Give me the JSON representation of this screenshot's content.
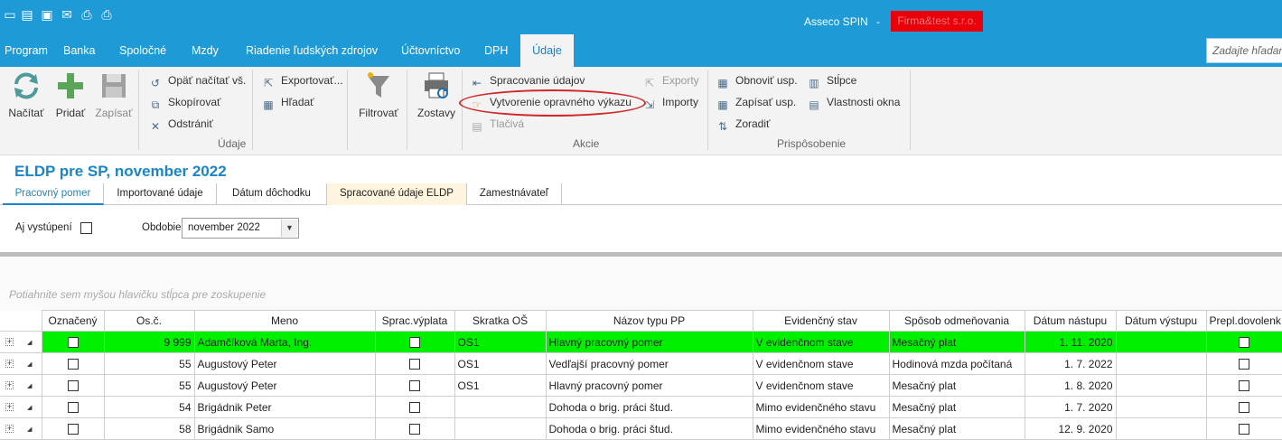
{
  "titlebar": {
    "app_name": "Asseco SPIN",
    "separator": "-",
    "company": "Firma&test s.r.o."
  },
  "menu": {
    "tabs": [
      "Program",
      "Banka",
      "Spoločné",
      "Mzdy",
      "Riadenie ľudských zdrojov",
      "Účtovníctvo",
      "DPH",
      "Údaje"
    ],
    "active": "Údaje",
    "search_placeholder": "Zadajte hľadaný"
  },
  "ribbon": {
    "udaje_group": {
      "label": "Údaje",
      "nacitat": "Načítať",
      "pridat": "Pridať",
      "zapisat": "Zapísať",
      "opat_nacitat": "Opäť načítať vš.",
      "skopirovat": "Skopírovať",
      "odstranit": "Odstrániť",
      "exportovat": "Exportovať...",
      "hladat": "Hľadať"
    },
    "filtrovat": "Filtrovať",
    "zostavy": "Zostavy",
    "akcie_group": {
      "label": "Akcie",
      "spracovanie": "Spracovanie údajov",
      "vytvorenie": "Vytvorenie opravného výkazu",
      "tlaciva": "Tlačivá",
      "exporty": "Exporty",
      "importy": "Importy"
    },
    "prisposobenie_group": {
      "label": "Prispôsobenie",
      "obnovit": "Obnoviť usp.",
      "zapisat_usp": "Zapísať usp.",
      "zoradit": "Zoradiť",
      "stlpce": "Stĺpce",
      "vlastnosti": "Vlastnosti okna"
    }
  },
  "page": {
    "title": "ELDP pre SP, november 2022",
    "subtabs": [
      "Pracovný pomer",
      "Importované údaje",
      "Dátum dôchodku",
      "Spracované údaje ELDP",
      "Zamestnávateľ"
    ],
    "filter_vystupeni_label": "Aj vystúpení",
    "filter_obdobie_label": "Obdobie",
    "filter_obdobie_value": "november 2022",
    "group_hint": "Potiahnite sem myšou hlavičku stĺpca pre zoskupenie"
  },
  "grid": {
    "columns": [
      "Označený",
      "Os.č.",
      "Meno",
      "Sprac.výplata",
      "Skratka OŠ",
      "Názov typu PP",
      "Evidenčný stav",
      "Spôsob odmeňovania",
      "Dátum nástupu",
      "Dátum výstupu",
      "Prepl.dovolenk"
    ],
    "rows": [
      {
        "osc": "9 999",
        "meno": "Adamčíková Marta, Ing.",
        "skratka": "OS1",
        "typ": "Hlavný pracovný pomer",
        "stav": "V evidenčnom stave",
        "odmena": "Mesačný plat",
        "nastup": "1. 11. 2020",
        "vystup": "",
        "selected": true
      },
      {
        "osc": "55",
        "meno": "Augustový Peter",
        "skratka": "OS1",
        "typ": "Vedľajší pracovný pomer",
        "stav": "V evidenčnom stave",
        "odmena": "Hodinová mzda počítaná",
        "nastup": "1. 7. 2022",
        "vystup": "",
        "selected": false
      },
      {
        "osc": "55",
        "meno": "Augustový Peter",
        "skratka": "OS1",
        "typ": "Hlavný pracovný pomer",
        "stav": "V evidenčnom stave",
        "odmena": "Mesačný plat",
        "nastup": "1. 8. 2020",
        "vystup": "",
        "selected": false
      },
      {
        "osc": "54",
        "meno": "Brigádnik Peter",
        "skratka": "",
        "typ": "Dohoda o brig. práci štud.",
        "stav": "Mimo evidenčného stavu",
        "odmena": "Mesačný plat",
        "nastup": "1. 7. 2020",
        "vystup": "",
        "selected": false
      },
      {
        "osc": "58",
        "meno": "Brigádnik Samo",
        "skratka": "",
        "typ": "Dohoda o brig. práci štud.",
        "stav": "Mimo evidenčného stavu",
        "odmena": "Mesačný plat",
        "nastup": "12. 9. 2020",
        "vystup": "",
        "selected": false
      }
    ]
  },
  "colors": {
    "brand_blue": "#1e9bd7",
    "selected_row": "#00f000",
    "company_badge": "#e8000b",
    "annotation_ellipse": "#d0282c"
  }
}
